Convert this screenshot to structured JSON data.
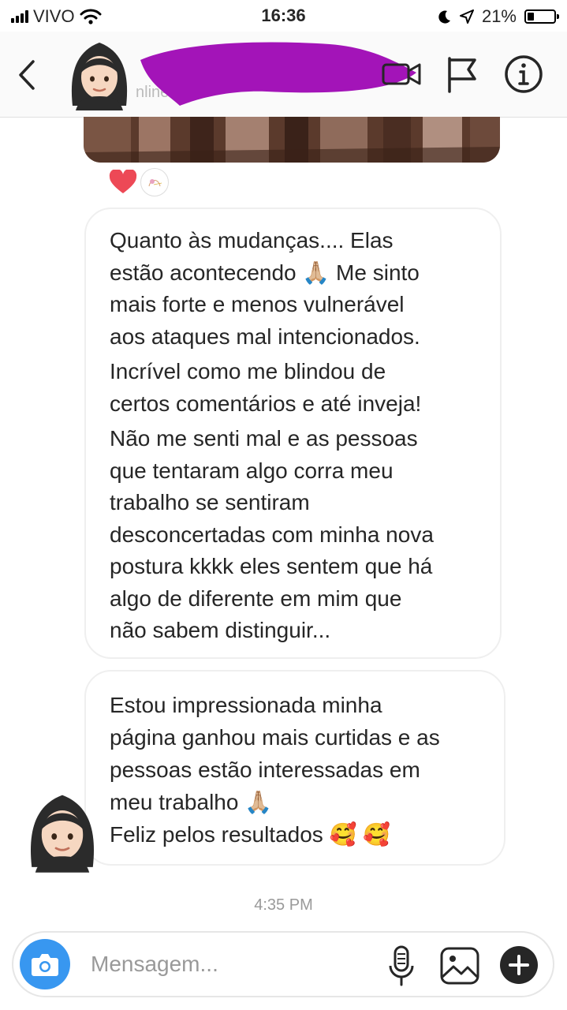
{
  "status_bar": {
    "carrier": "VIVO",
    "time": "16:36",
    "battery": "21%",
    "icons": [
      "signal-icon",
      "wifi-icon",
      "moon-icon",
      "location-arrow-icon",
      "battery-icon"
    ]
  },
  "header": {
    "subtitle_partial": "nline",
    "icons": [
      "back-chevron-icon",
      "video-call-icon",
      "flag-icon",
      "info-icon"
    ]
  },
  "reactions": {
    "icons": [
      "heart-icon"
    ],
    "colors": {
      "heart": "#ed4956"
    }
  },
  "messages": {
    "msg1": {
      "paragraph1": "Quanto às mudanças.... Elas\nestão acontecendo 🙏🏼 Me sinto\nmais forte e menos vulnerável\naos ataques mal intencionados.",
      "paragraph2": "Incrível como me blindou de\ncertos comentários e até inveja!",
      "paragraph3": "Não me senti mal e as pessoas\nque tentaram algo corra meu\ntrabalho se sentiram\ndesconcertadas com minha nova\npostura kkkk eles sentem que há\nalgo de diferente em mim que\nnão sabem distinguir..."
    },
    "msg2": {
      "text": "Estou impressionada minha\npágina ganhou mais curtidas e as\npessoas estão interessadas em\nmeu trabalho 🙏🏼\nFeliz pelos resultados 🥰 🥰"
    },
    "timestamp": "4:35 PM"
  },
  "composer": {
    "placeholder": "Mensagem...",
    "icons": [
      "camera-icon",
      "microphone-icon",
      "gallery-icon",
      "plus-icon"
    ],
    "colors": {
      "camera_button": "#3897f0"
    }
  },
  "colors": {
    "redaction": "#a314b8",
    "bubble_border": "#efefef",
    "text": "#262626"
  }
}
